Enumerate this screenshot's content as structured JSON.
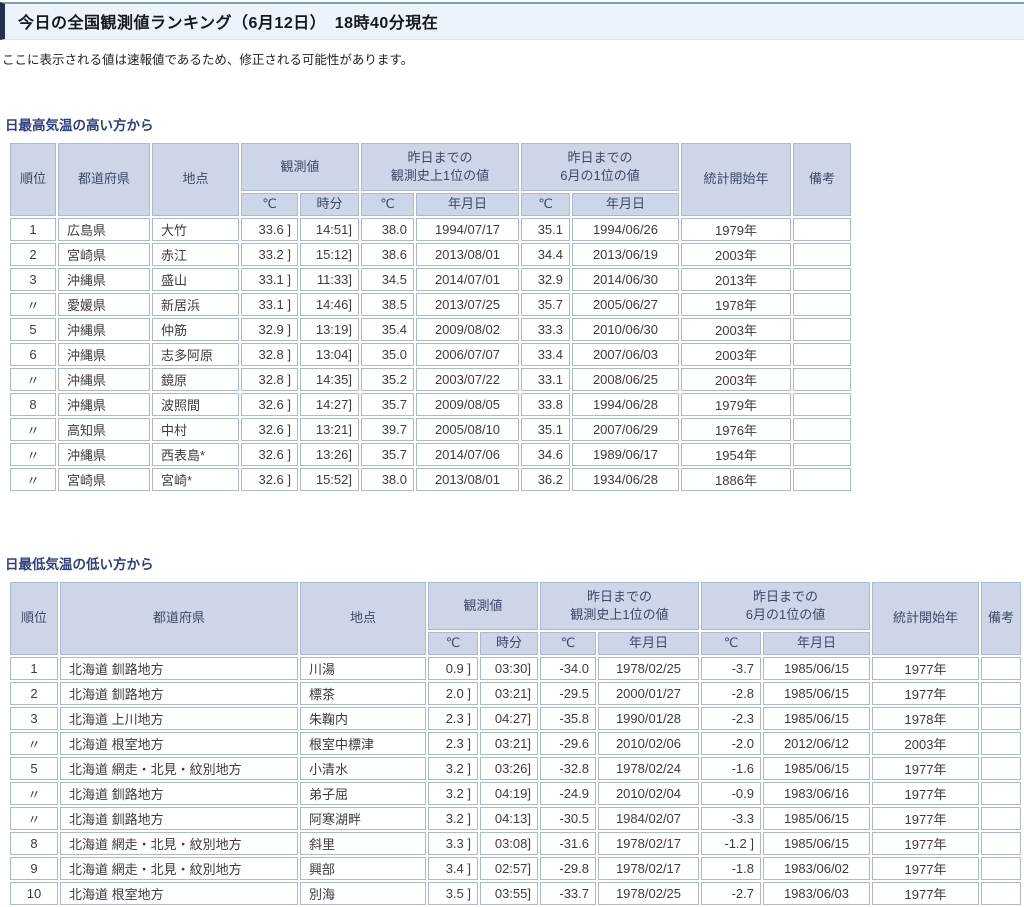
{
  "page": {
    "title": "今日の全国観測値ランキング（6月12日）　18時40分現在",
    "notice": "ここに表示される値は速報値であるため、修正される可能性があります。"
  },
  "colors": {
    "title_bar_bg": "#edf3fa",
    "title_bar_accent": "#25304a",
    "table_header_bg": "#cdd6e8",
    "table_border": "#a9b9d6",
    "section_title_text": "#2e3e80"
  },
  "tables": [
    {
      "section_title": "日最高気温の高い方から",
      "header": {
        "rank": "順位",
        "pref": "都道府県",
        "station": "地点",
        "obs": "観測値",
        "record": "昨日までの\n観測史上1位の値",
        "june": "昨日までの\n6月の1位の値",
        "stats": "統計開始年",
        "remarks": "備考",
        "sub": [
          "℃",
          "時分",
          "℃",
          "年月日",
          "℃",
          "年月日"
        ]
      },
      "rows": [
        [
          "1",
          "広島県",
          "大竹",
          "33.6 ]",
          "14:51]",
          "38.0",
          "1994/07/17",
          "35.1",
          "1994/06/26",
          "1979年",
          ""
        ],
        [
          "2",
          "宮崎県",
          "赤江",
          "33.2 ]",
          "15:12]",
          "38.6",
          "2013/08/01",
          "34.4",
          "2013/06/19",
          "2003年",
          ""
        ],
        [
          "3",
          "沖縄県",
          "盛山",
          "33.1 ]",
          "11:33]",
          "34.5",
          "2014/07/01",
          "32.9",
          "2014/06/30",
          "2013年",
          ""
        ],
        [
          "〃",
          "愛媛県",
          "新居浜",
          "33.1 ]",
          "14:46]",
          "38.5",
          "2013/07/25",
          "35.7",
          "2005/06/27",
          "1978年",
          ""
        ],
        [
          "5",
          "沖縄県",
          "仲筋",
          "32.9 ]",
          "13:19]",
          "35.4",
          "2009/08/02",
          "33.3",
          "2010/06/30",
          "2003年",
          ""
        ],
        [
          "6",
          "沖縄県",
          "志多阿原",
          "32.8 ]",
          "13:04]",
          "35.0",
          "2006/07/07",
          "33.4",
          "2007/06/03",
          "2003年",
          ""
        ],
        [
          "〃",
          "沖縄県",
          "鏡原",
          "32.8 ]",
          "14:35]",
          "35.2",
          "2003/07/22",
          "33.1",
          "2008/06/25",
          "2003年",
          ""
        ],
        [
          "8",
          "沖縄県",
          "波照間",
          "32.6 ]",
          "14:27]",
          "35.7",
          "2009/08/05",
          "33.8",
          "1994/06/28",
          "1979年",
          ""
        ],
        [
          "〃",
          "高知県",
          "中村",
          "32.6 ]",
          "13:21]",
          "39.7",
          "2005/08/10",
          "35.1",
          "2007/06/29",
          "1976年",
          ""
        ],
        [
          "〃",
          "沖縄県",
          "西表島*",
          "32.6 ]",
          "13:26]",
          "35.7",
          "2014/07/06",
          "34.6",
          "1989/06/17",
          "1954年",
          ""
        ],
        [
          "〃",
          "宮崎県",
          "宮崎*",
          "32.6 ]",
          "15:52]",
          "38.0",
          "2013/08/01",
          "36.2",
          "1934/06/28",
          "1886年",
          ""
        ]
      ]
    },
    {
      "section_title": "日最低気温の低い方から",
      "header": {
        "rank": "順位",
        "pref": "都道府県",
        "station": "地点",
        "obs": "観測値",
        "record": "昨日までの\n観測史上1位の値",
        "june": "昨日までの\n6月の1位の値",
        "stats": "統計開始年",
        "remarks": "備考",
        "sub": [
          "℃",
          "時分",
          "℃",
          "年月日",
          "℃",
          "年月日"
        ]
      },
      "rows": [
        [
          "1",
          "北海道 釧路地方",
          "川湯",
          "0.9 ]",
          "03:30]",
          "-34.0",
          "1978/02/25",
          "-3.7",
          "1985/06/15",
          "1977年",
          ""
        ],
        [
          "2",
          "北海道 釧路地方",
          "標茶",
          "2.0 ]",
          "03:21]",
          "-29.5",
          "2000/01/27",
          "-2.8",
          "1985/06/15",
          "1977年",
          ""
        ],
        [
          "3",
          "北海道 上川地方",
          "朱鞠内",
          "2.3 ]",
          "04:27]",
          "-35.8",
          "1990/01/28",
          "-2.3",
          "1985/06/15",
          "1978年",
          ""
        ],
        [
          "〃",
          "北海道 根室地方",
          "根室中標津",
          "2.3 ]",
          "03:21]",
          "-29.6",
          "2010/02/06",
          "-2.0",
          "2012/06/12",
          "2003年",
          ""
        ],
        [
          "5",
          "北海道 網走・北見・紋別地方",
          "小清水",
          "3.2 ]",
          "03:26]",
          "-32.8",
          "1978/02/24",
          "-1.6",
          "1985/06/15",
          "1977年",
          ""
        ],
        [
          "〃",
          "北海道 釧路地方",
          "弟子屈",
          "3.2 ]",
          "04:19]",
          "-24.9",
          "2010/02/04",
          "-0.9",
          "1983/06/16",
          "1977年",
          ""
        ],
        [
          "〃",
          "北海道 釧路地方",
          "阿寒湖畔",
          "3.2 ]",
          "04:13]",
          "-30.5",
          "1984/02/07",
          "-3.3",
          "1985/06/15",
          "1977年",
          ""
        ],
        [
          "8",
          "北海道 網走・北見・紋別地方",
          "斜里",
          "3.3 ]",
          "03:08]",
          "-31.6",
          "1978/02/17",
          "-1.2 ]",
          "1985/06/15",
          "1977年",
          ""
        ],
        [
          "9",
          "北海道 網走・北見・紋別地方",
          "興部",
          "3.4 ]",
          "02:57]",
          "-29.8",
          "1978/02/17",
          "-1.8",
          "1983/06/02",
          "1977年",
          ""
        ],
        [
          "10",
          "北海道 根室地方",
          "別海",
          "3.5 ]",
          "03:55]",
          "-33.7",
          "1978/02/25",
          "-2.7",
          "1983/06/03",
          "1977年",
          ""
        ]
      ]
    }
  ]
}
